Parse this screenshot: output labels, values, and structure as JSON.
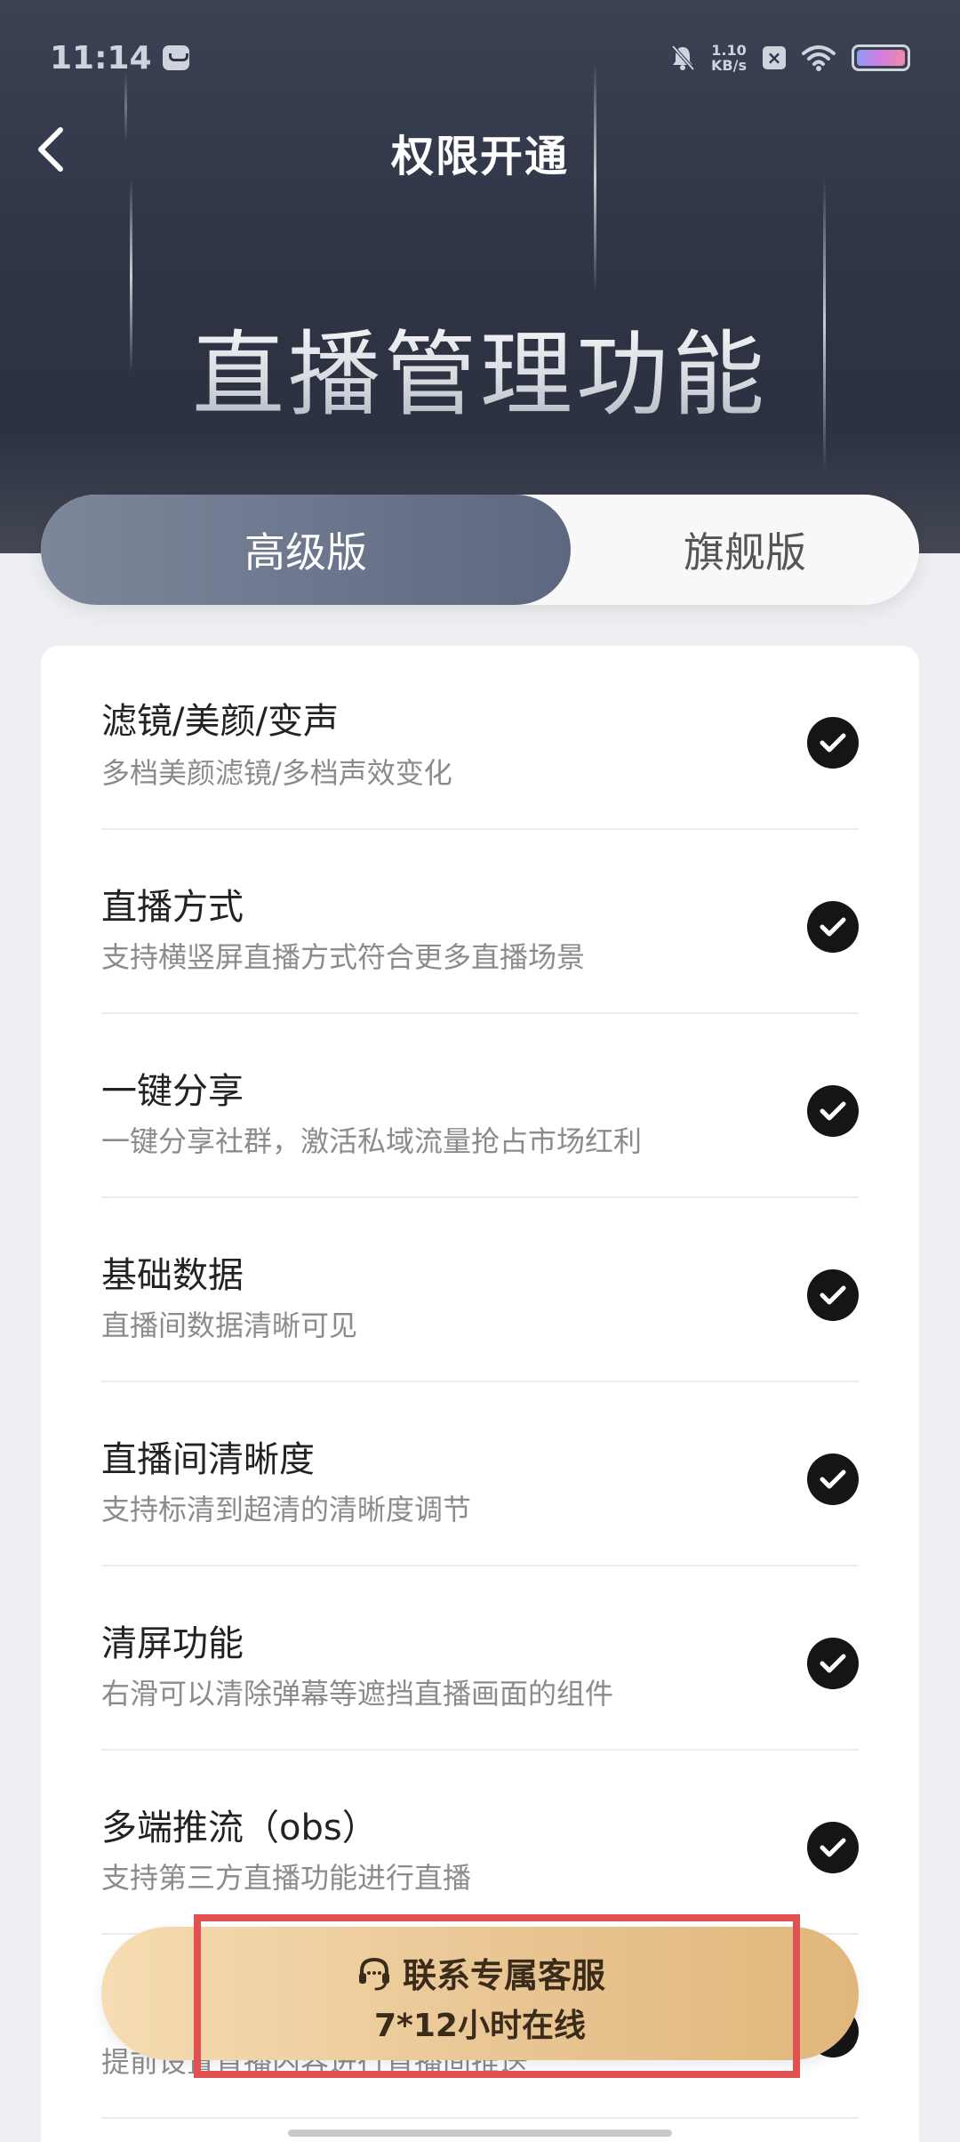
{
  "status_bar": {
    "time": "11:14",
    "net_speed_value": "1.10",
    "net_speed_unit": "KB/s",
    "icons": [
      "message-icon",
      "bell-off-icon",
      "notification-x-icon",
      "wifi-icon",
      "battery-icon"
    ]
  },
  "header": {
    "title": "权限开通",
    "hero_text": "直播管理功能"
  },
  "tabs": [
    {
      "label": "高级版",
      "active": true
    },
    {
      "label": "旗舰版",
      "active": false
    }
  ],
  "features": [
    {
      "name": "滤镜/美颜/变声",
      "desc": "多档美颜滤镜/多档声效变化",
      "included": true
    },
    {
      "name": "直播方式",
      "desc": "支持横竖屏直播方式符合更多直播场景",
      "included": true
    },
    {
      "name": "一键分享",
      "desc": "一键分享社群，激活私域流量抢占市场红利",
      "included": true
    },
    {
      "name": "基础数据",
      "desc": "直播间数据清晰可见",
      "included": true
    },
    {
      "name": "直播间清晰度",
      "desc": "支持标清到超清的清晰度调节",
      "included": true
    },
    {
      "name": "清屏功能",
      "desc": "右滑可以清除弹幕等遮挡直播画面的组件",
      "included": true
    },
    {
      "name": "多端推流（obs）",
      "desc": "支持第三方直播功能进行直播",
      "included": true
    },
    {
      "name": "",
      "desc": "提前设置直播内容进行直播间推送",
      "included": true
    }
  ],
  "contact": {
    "line1": "联系专属客服",
    "line2": "7*12小时在线"
  },
  "colors": {
    "header_bg": "#2f3546",
    "tab_active": "#6b768c",
    "check": "#151515",
    "contact_gold": "#eac795",
    "highlight": "#e05252"
  }
}
